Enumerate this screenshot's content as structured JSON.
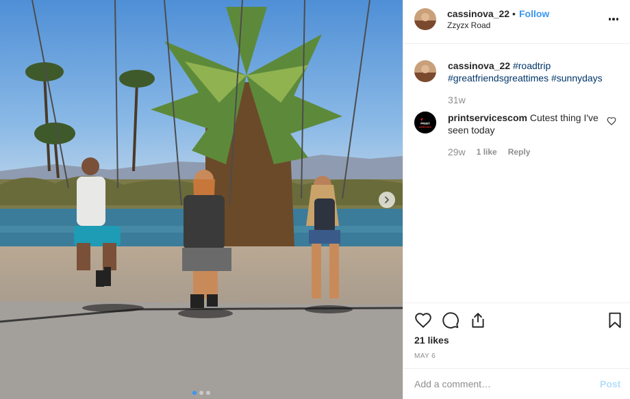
{
  "post": {
    "author": "cassinova_22",
    "separator": "•",
    "follow_label": "Follow",
    "location": "Zzyzx Road",
    "more_icon": "more-options-icon",
    "photo": {
      "description_icon": "photo",
      "carousel_total": 3,
      "carousel_active": 1,
      "next_icon": "chevron-right-icon"
    }
  },
  "caption": {
    "username": "cassinova_22",
    "hashtags": [
      "#roadtrip",
      "#greatfriendsgreattimes",
      "#sunnydays"
    ],
    "time": "31w"
  },
  "comment": {
    "username": "printservicescom",
    "text": "Cutest thing I've seen today",
    "time": "29w",
    "likes_label": "1 like",
    "reply_label": "Reply",
    "avatar_text": "PRINT SERVICES"
  },
  "actions": {
    "like_icon": "heart-icon",
    "comment_icon": "comment-icon",
    "share_icon": "share-icon",
    "save_icon": "bookmark-icon",
    "likes_count": "21 likes",
    "date": "MAY 6"
  },
  "add_comment": {
    "placeholder": "Add a comment…",
    "post_label": "Post"
  },
  "colors": {
    "link_blue": "#3897f0",
    "hashtag": "#003569",
    "muted": "#8e8e8e",
    "post_disabled": "#b2dffc"
  }
}
